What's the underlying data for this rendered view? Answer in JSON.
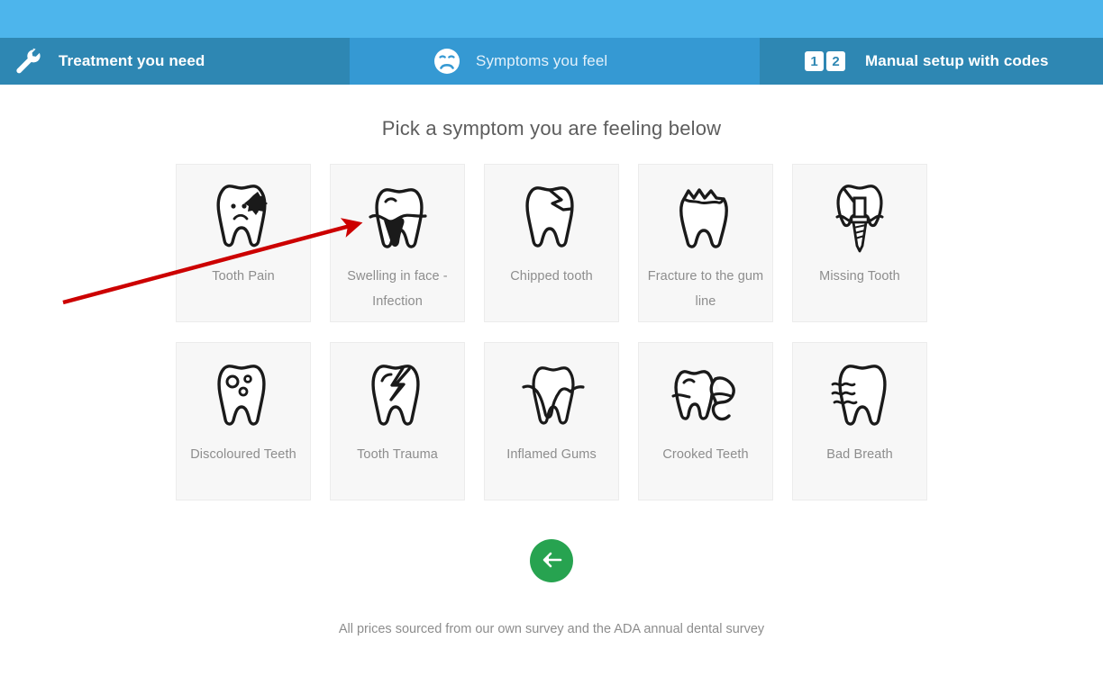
{
  "header": {
    "tabs": [
      {
        "label": "Treatment you need",
        "icon": "wrench-icon",
        "state": "inactive"
      },
      {
        "label": "Symptoms you feel",
        "icon": "sad-face-icon",
        "state": "active"
      },
      {
        "label": "Manual setup with codes",
        "icon": "number-codes-icon",
        "state": "inactive"
      }
    ],
    "code_badges": [
      "1",
      "2"
    ],
    "colors": {
      "top_strip": "#4db5ec",
      "active_tab": "#3599d3",
      "inactive_tab": "#2e87b3",
      "tab_text": "#ffffff"
    }
  },
  "main": {
    "title": "Pick a symptom you are feeling below",
    "symptoms": [
      [
        {
          "label": "Tooth Pain",
          "icon": "sad-tooth-cavity-icon"
        },
        {
          "label": "Swelling in face - Infection",
          "icon": "tooth-swelling-infection-icon"
        },
        {
          "label": "Chipped tooth",
          "icon": "chipped-tooth-icon"
        },
        {
          "label": "Fracture to the gum line",
          "icon": "fractured-tooth-icon"
        },
        {
          "label": "Missing Tooth",
          "icon": "dental-implant-icon"
        }
      ],
      [
        {
          "label": "Discoloured Teeth",
          "icon": "spotted-tooth-icon"
        },
        {
          "label": "Tooth Trauma",
          "icon": "cracked-tooth-lightning-icon"
        },
        {
          "label": "Inflamed Gums",
          "icon": "inflamed-gums-tooth-icon"
        },
        {
          "label": "Crooked Teeth",
          "icon": "crooked-teeth-icon"
        },
        {
          "label": "Bad Breath",
          "icon": "bad-breath-tooth-icon"
        }
      ]
    ],
    "card_colors": {
      "background": "#f7f7f7",
      "border": "#ececec",
      "label_text": "#8d8d8d"
    }
  },
  "back_button": {
    "icon": "arrow-left-icon",
    "color": "#27a350"
  },
  "footer": {
    "note": "All prices sourced from our own survey and the ADA annual dental survey"
  },
  "annotation": {
    "arrow_color": "#cc0000"
  }
}
